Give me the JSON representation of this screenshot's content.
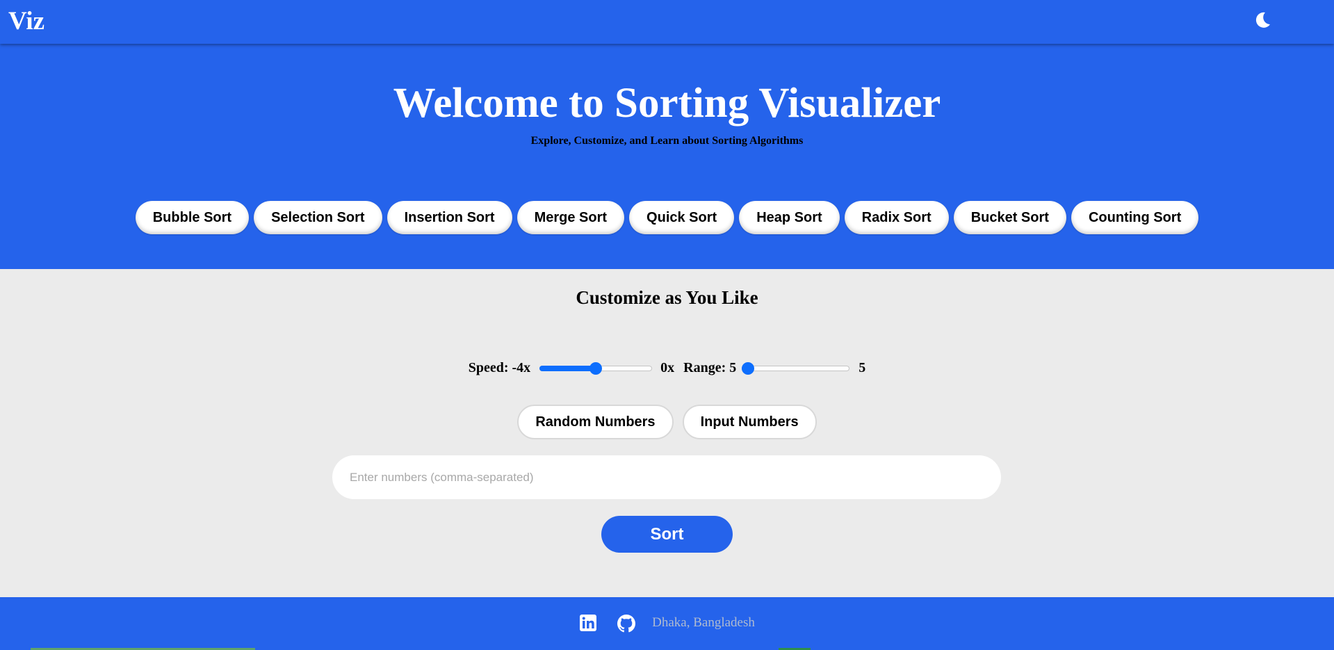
{
  "navbar": {
    "brand": "Viz",
    "theme_icon": "moon-icon"
  },
  "hero": {
    "title": "Welcome to Sorting Visualizer",
    "subtitle": "Explore, Customize, and Learn about Sorting Algorithms",
    "algorithms": [
      "Bubble Sort",
      "Selection Sort",
      "Insertion Sort",
      "Merge Sort",
      "Quick Sort",
      "Heap Sort",
      "Radix Sort",
      "Bucket Sort",
      "Counting Sort"
    ]
  },
  "customize": {
    "title": "Customize as You Like",
    "speed": {
      "label": "Speed: -4x",
      "max_label": "0x",
      "fraction": 0.5
    },
    "range": {
      "label": "Range: 5",
      "max_label": "5",
      "fraction": 0.0
    },
    "random_button": "Random Numbers",
    "input_button": "Input Numbers",
    "numbers_input": {
      "value": "",
      "placeholder": "Enter numbers (comma-separated)"
    },
    "sort_button": "Sort"
  },
  "footer": {
    "links": [
      {
        "icon": "linkedin-icon"
      },
      {
        "icon": "github-icon"
      }
    ],
    "location": "Dhaka, Bangladesh"
  },
  "colors": {
    "primary": "#2563eb",
    "background": "#ebebeb",
    "slider_accent": "#0d6efd"
  }
}
